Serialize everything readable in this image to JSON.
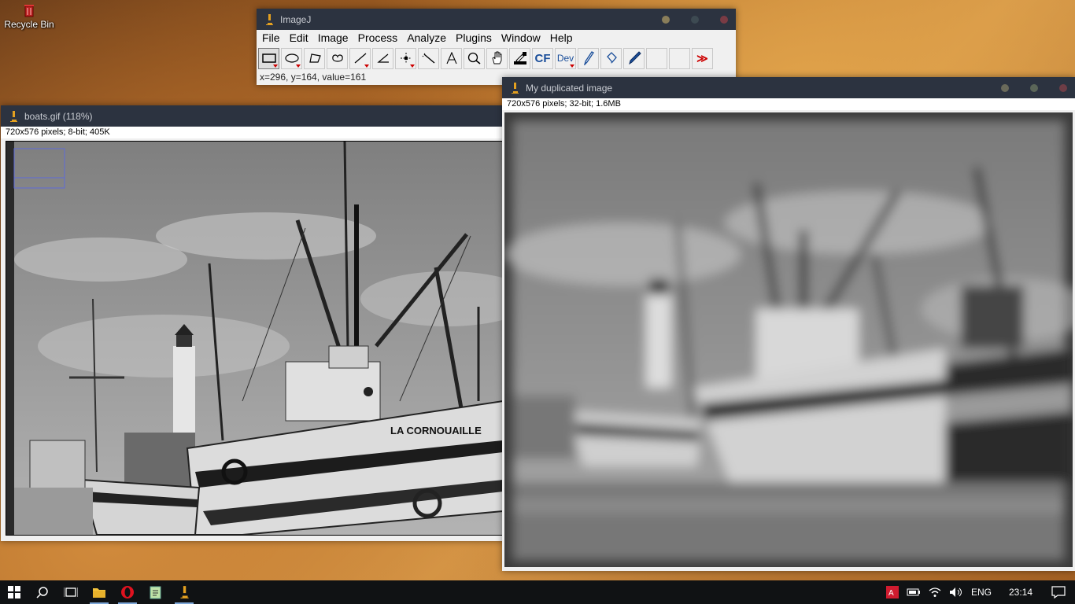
{
  "desktop": {
    "recycle_bin_label": "Recycle Bin"
  },
  "imagej": {
    "title": "ImageJ",
    "menus": [
      "File",
      "Edit",
      "Image",
      "Process",
      "Analyze",
      "Plugins",
      "Window",
      "Help"
    ],
    "tools": [
      {
        "name": "rectangle-tool-icon",
        "selected": true,
        "menu": true
      },
      {
        "name": "oval-tool-icon",
        "menu": true
      },
      {
        "name": "polygon-tool-icon"
      },
      {
        "name": "freehand-tool-icon"
      },
      {
        "name": "line-tool-icon",
        "menu": true
      },
      {
        "name": "angle-tool-icon"
      },
      {
        "name": "point-tool-icon",
        "menu": true
      },
      {
        "name": "wand-tool-icon"
      },
      {
        "name": "text-tool-icon"
      },
      {
        "name": "magnifier-tool-icon"
      },
      {
        "name": "hand-tool-icon"
      },
      {
        "name": "color-picker-tool-icon"
      },
      {
        "name": "cf-tool",
        "label": "CF"
      },
      {
        "name": "dev-tool",
        "label": "Dev",
        "menu": true
      },
      {
        "name": "brush-tool-icon"
      },
      {
        "name": "flood-fill-tool-icon"
      },
      {
        "name": "pencil-tool-icon"
      },
      {
        "name": "blank-tool-1"
      },
      {
        "name": "blank-tool-2"
      },
      {
        "name": "more-tools-icon",
        "label": "≫"
      }
    ],
    "status": "x=296, y=164, value=161"
  },
  "boats_window": {
    "title": "boats.gif (118%)",
    "info": "720x576 pixels; 8-bit; 405K",
    "overlay_text": "LA CORNOUAILLE"
  },
  "dup_window": {
    "title": "My duplicated image",
    "info": "720x576 pixels; 32-bit; 1.6MB"
  },
  "taskbar": {
    "language": "ENG",
    "time": "23:14"
  },
  "colors": {
    "titlebar": "#2c3340",
    "taskbar": "#101214",
    "accent": "#7da7d8"
  }
}
